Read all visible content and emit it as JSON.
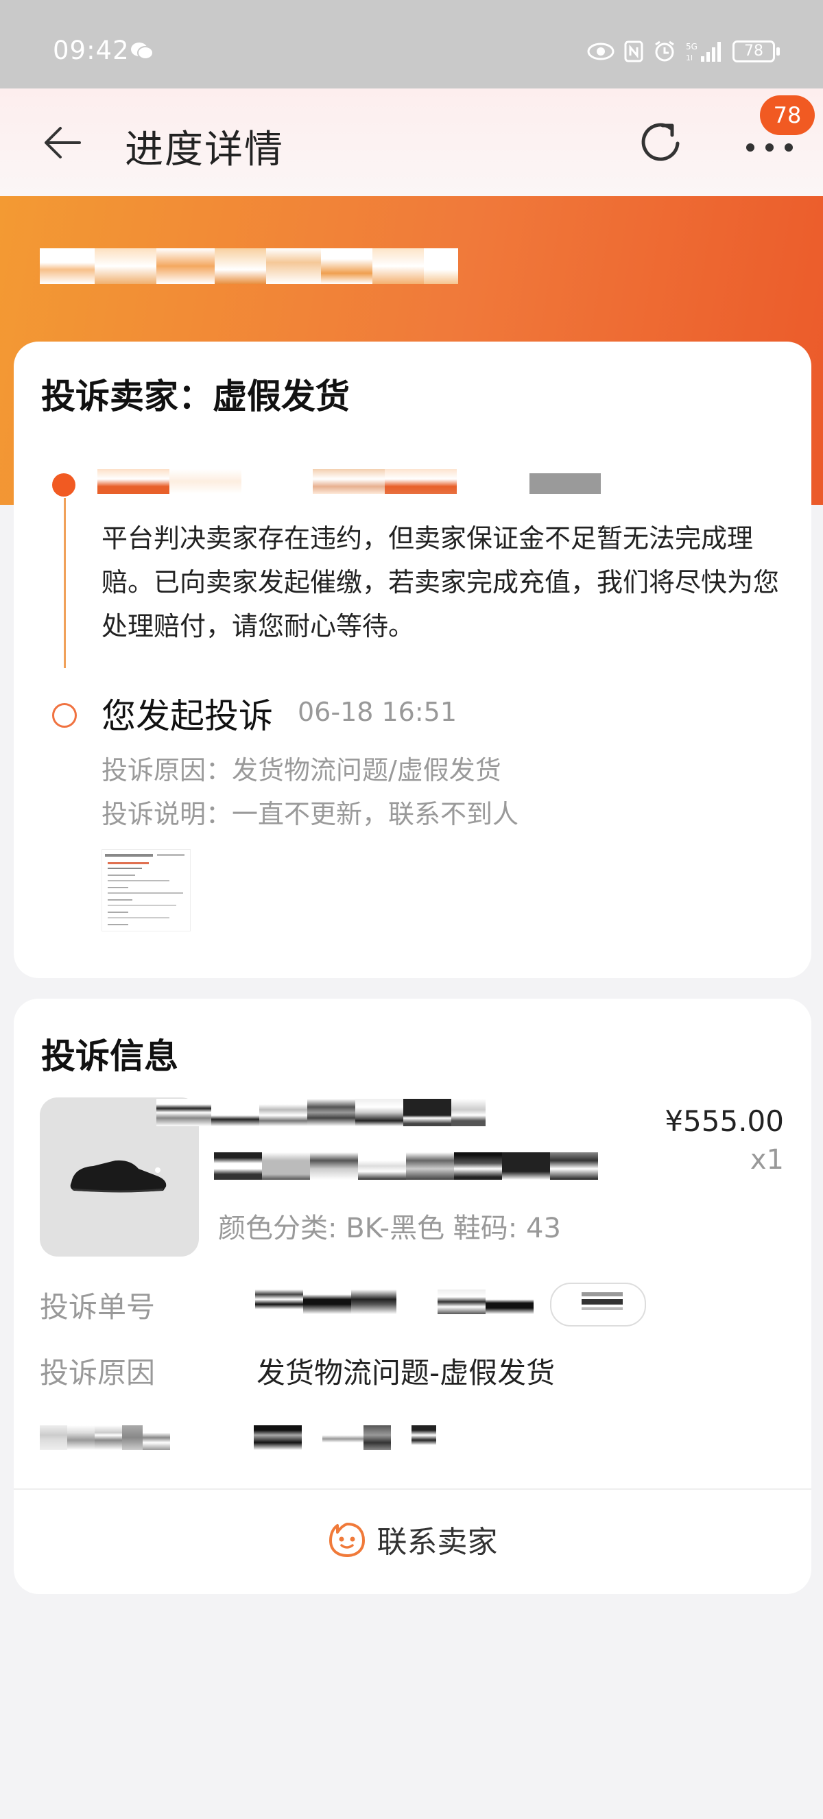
{
  "status_bar": {
    "time": "09:42",
    "battery": "78"
  },
  "header": {
    "title": "进度详情",
    "badge": "78"
  },
  "complaint": {
    "title": "投诉卖家：虚假发货",
    "judgement_text": "平台判决卖家存在违约，但卖家保证金不足暂无法完成理赔。已向卖家发起催缴，若卖家完成充值，我们将尽快为您处理赔付，请您耐心等待。",
    "event_title": "您发起投诉",
    "event_time": "06-18 16:51",
    "reason": "投诉原因：发货物流问题/虚假发货",
    "description": "投诉说明：一直不更新，联系不到人"
  },
  "info": {
    "title": "投诉信息",
    "price": "¥555.00",
    "quantity": "x1",
    "spec": "颜色分类: BK-黑色 鞋码: 43",
    "order_no_label": "投诉单号",
    "reason_label": "投诉原因",
    "reason_value": "发货物流问题-虚假发货",
    "contact_label": "联系卖家"
  }
}
